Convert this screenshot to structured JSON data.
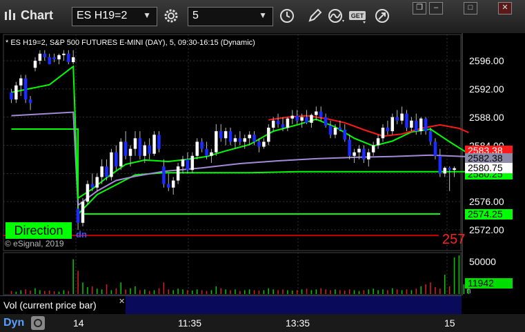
{
  "app": {
    "title": "Chart"
  },
  "toolbar": {
    "symbol": "ES H19=2",
    "interval": "5",
    "dropdown_glyph": "▼"
  },
  "icons": [
    "chart-app-icon",
    "gear-icon",
    "clock-icon",
    "pencil-icon",
    "curve-icon",
    "get-icon",
    "arrow-circle-icon",
    "restore-icon",
    "minimize-icon",
    "maximize-icon",
    "close-icon"
  ],
  "window_buttons": {
    "restore": "❐",
    "minimize": "–",
    "maximize": "□",
    "close": "✕"
  },
  "chart_header": "* ES H19=2, S&P 500 FUTURES E-MINI (DAY), 5, 09:30-16:15 (Dynamic)",
  "direction_label": "Direction",
  "copyright": "© eSignal, 2019",
  "dn_label": "dn",
  "price_axis": {
    "ticks": [
      "2596.00",
      "2592.00",
      "2588.00",
      "2584.00",
      "2576.00",
      "2572.00"
    ],
    "red_line_value": "2583.38",
    "gray_line_value": "2582.38",
    "last_price": "2580.75",
    "green_line_value": "2580.25",
    "support_value": "2574.25",
    "partial_red_label": "257"
  },
  "volume_axis": {
    "tick": "50000",
    "current_volume": "11942",
    "unit_glyph": "n"
  },
  "volume_panel": {
    "label": "Vol (current price bar)",
    "close_glyph": "✕"
  },
  "bottom": {
    "mode": "Dyn",
    "time_ticks": [
      "14",
      "11:35",
      "13:35",
      "15"
    ]
  },
  "colors": {
    "up_candle": "#ffffff",
    "down_candle": "#1a2cff",
    "red_ma": "#ff1a1a",
    "green_ma": "#00ff00",
    "purple_line": "#a58ad8",
    "support_line": "#00ff00",
    "level_line": "#cc0000"
  },
  "chart_data": {
    "type": "candlestick",
    "ylim": [
      2570,
      2599
    ],
    "ohlc": [
      [
        2591.5,
        2592,
        2590,
        2590.5
      ],
      [
        2590.5,
        2593,
        2590,
        2592.5
      ],
      [
        2592.5,
        2594,
        2591,
        2593.5
      ],
      [
        2593.5,
        2594,
        2590,
        2590.5
      ],
      [
        2590.5,
        2591,
        2589,
        2590
      ],
      [
        2595,
        2596.5,
        2594.5,
        2596
      ],
      [
        2596,
        2597.5,
        2595.5,
        2597
      ],
      [
        2597,
        2597.5,
        2596,
        2596.5
      ],
      [
        2596.5,
        2597,
        2595.5,
        2595.5
      ],
      [
        2596.5,
        2597,
        2595.8,
        2596.2
      ],
      [
        2596.2,
        2597,
        2595.5,
        2596.8
      ],
      [
        2596.8,
        2597.5,
        2596,
        2597
      ],
      [
        2597,
        2597.5,
        2595.5,
        2595.8
      ],
      [
        2595.8,
        2597.5,
        2595.5,
        2596.5
      ],
      [
        2575,
        2576,
        2572,
        2573
      ],
      [
        2573,
        2576.5,
        2572.5,
        2576
      ],
      [
        2576,
        2579,
        2575.5,
        2578.5
      ],
      [
        2578.5,
        2580,
        2577.5,
        2578
      ],
      [
        2578,
        2580,
        2577.5,
        2579.5
      ],
      [
        2579.5,
        2582,
        2578.5,
        2581
      ],
      [
        2581,
        2582,
        2579,
        2579.5
      ],
      [
        2579.5,
        2583.5,
        2579,
        2583
      ],
      [
        2583,
        2584,
        2580.5,
        2581
      ],
      [
        2581,
        2585,
        2580.5,
        2584.5
      ],
      [
        2584.5,
        2586,
        2582,
        2582.5
      ],
      [
        2582.5,
        2584,
        2581,
        2583.5
      ],
      [
        2583.5,
        2586,
        2582.5,
        2585
      ],
      [
        2585,
        2586,
        2582,
        2582.5
      ],
      [
        2582.5,
        2584.5,
        2581.5,
        2584
      ],
      [
        2584,
        2585,
        2582,
        2582.8
      ],
      [
        2582.8,
        2586,
        2582.5,
        2585.5
      ],
      [
        2585.5,
        2586,
        2583,
        2583.5
      ],
      [
        2581,
        2582,
        2578,
        2578.5
      ],
      [
        2578.5,
        2580,
        2577.5,
        2578
      ],
      [
        2578,
        2579.5,
        2577,
        2579
      ],
      [
        2579,
        2581.5,
        2578.5,
        2581
      ],
      [
        2581,
        2582.5,
        2580,
        2582
      ],
      [
        2582,
        2583,
        2580,
        2580.5
      ],
      [
        2580.5,
        2583,
        2580,
        2582.5
      ],
      [
        2582.5,
        2585,
        2582,
        2584.5
      ],
      [
        2584.5,
        2585,
        2583,
        2583.5
      ],
      [
        2583.5,
        2584.5,
        2582,
        2582.5
      ],
      [
        2582.5,
        2583.5,
        2581.5,
        2583
      ],
      [
        2583,
        2587,
        2582.5,
        2586
      ],
      [
        2586,
        2587,
        2584.5,
        2585
      ],
      [
        2585,
        2586.5,
        2584,
        2586
      ],
      [
        2586,
        2586.5,
        2584,
        2584.5
      ],
      [
        2584.5,
        2585.5,
        2583.5,
        2585
      ],
      [
        2585,
        2586,
        2584,
        2584.5
      ],
      [
        2584.5,
        2585.5,
        2583.5,
        2585
      ],
      [
        2585,
        2586,
        2584,
        2585.5
      ],
      [
        2585.5,
        2586,
        2584,
        2584.5
      ],
      [
        2584.5,
        2585,
        2583,
        2583.8
      ],
      [
        2583.8,
        2585,
        2583.5,
        2584.5
      ],
      [
        2584.5,
        2587,
        2584,
        2586.5
      ],
      [
        2586.5,
        2588,
        2586,
        2587.5
      ],
      [
        2587.5,
        2588.5,
        2586.5,
        2587
      ],
      [
        2587,
        2588,
        2586,
        2586.5
      ],
      [
        2586.5,
        2588,
        2586,
        2587.8
      ],
      [
        2587.8,
        2589,
        2587,
        2588.2
      ],
      [
        2588.2,
        2589,
        2587,
        2587.5
      ],
      [
        2587.5,
        2588.5,
        2586.5,
        2588
      ],
      [
        2588,
        2589,
        2587,
        2587.2
      ],
      [
        2587.2,
        2588.5,
        2586.5,
        2588.3
      ],
      [
        2588.3,
        2589.5,
        2587.5,
        2588.8
      ],
      [
        2588.8,
        2589.5,
        2587.5,
        2588
      ],
      [
        2588,
        2588.5,
        2586.5,
        2586.8
      ],
      [
        2586.8,
        2587.5,
        2585,
        2585.5
      ],
      [
        2585.5,
        2587,
        2585,
        2586.5
      ],
      [
        2586.5,
        2587.5,
        2586,
        2586.2
      ],
      [
        2586.2,
        2587,
        2584.5,
        2584.8
      ],
      [
        2584.8,
        2585.5,
        2582,
        2582.5
      ],
      [
        2582.5,
        2583.5,
        2581.5,
        2583
      ],
      [
        2583,
        2584,
        2582,
        2583.5
      ],
      [
        2583.5,
        2584,
        2581.5,
        2582
      ],
      [
        2582,
        2583.5,
        2581,
        2583
      ],
      [
        2583,
        2584.5,
        2582.5,
        2584
      ],
      [
        2584,
        2585.5,
        2583.5,
        2585
      ],
      [
        2585,
        2587,
        2584.5,
        2586.5
      ],
      [
        2586.5,
        2587.5,
        2585.5,
        2586
      ],
      [
        2586,
        2588.5,
        2585.5,
        2588
      ],
      [
        2588,
        2589,
        2587,
        2587.5
      ],
      [
        2587.5,
        2589.5,
        2587,
        2588.5
      ],
      [
        2588.5,
        2589,
        2586,
        2586.5
      ],
      [
        2586.5,
        2588,
        2586,
        2587.5
      ],
      [
        2587.5,
        2588.5,
        2585.5,
        2586
      ],
      [
        2586,
        2588,
        2585.5,
        2587.8
      ],
      [
        2587.8,
        2588,
        2585.5,
        2586
      ],
      [
        2586,
        2586.5,
        2584,
        2584.5
      ],
      [
        2584.5,
        2585,
        2582,
        2582.5
      ],
      [
        2582.5,
        2583.5,
        2579.5,
        2580
      ],
      [
        2580,
        2581,
        2579.5,
        2580.8
      ],
      [
        2580.8,
        2581,
        2577.5,
        2580.5
      ],
      [
        2580.5,
        2581,
        2579.5,
        2580.75
      ]
    ],
    "red_ma": [
      [
        54,
        2587.6
      ],
      [
        58,
        2588.0
      ],
      [
        62,
        2588.2
      ],
      [
        66,
        2587.8
      ],
      [
        70,
        2587.2
      ],
      [
        74,
        2586.2
      ],
      [
        78,
        2585.3
      ],
      [
        82,
        2585.6
      ],
      [
        86,
        2586.4
      ],
      [
        90,
        2586.9
      ],
      [
        94,
        2586.4
      ],
      [
        96,
        2585.8
      ]
    ],
    "green_ma": [
      [
        0,
        2591.5
      ],
      [
        8,
        2592.6
      ],
      [
        13,
        2595.2
      ],
      [
        14,
        2576.5
      ],
      [
        17,
        2577.8
      ],
      [
        20,
        2579.4
      ],
      [
        24,
        2581.3
      ],
      [
        28,
        2581.9
      ],
      [
        33,
        2581.7
      ],
      [
        37,
        2582.0
      ],
      [
        41,
        2582.4
      ],
      [
        45,
        2583.2
      ],
      [
        50,
        2584.1
      ],
      [
        55,
        2586.0
      ],
      [
        60,
        2586.9
      ],
      [
        64,
        2587.7
      ],
      [
        68,
        2586.6
      ],
      [
        72,
        2585.0
      ],
      [
        76,
        2583.9
      ],
      [
        80,
        2584.6
      ],
      [
        84,
        2585.9
      ],
      [
        88,
        2586.3
      ],
      [
        92,
        2584.5
      ],
      [
        96,
        2582.8
      ]
    ],
    "purple_line": [
      [
        0,
        2588.2
      ],
      [
        13,
        2588.7
      ],
      [
        14,
        2575.5
      ],
      [
        18,
        2577.5
      ],
      [
        22,
        2579.0
      ],
      [
        26,
        2579.6
      ],
      [
        32,
        2580.3
      ],
      [
        40,
        2580.8
      ],
      [
        48,
        2581.4
      ],
      [
        56,
        2581.8
      ],
      [
        64,
        2582.1
      ],
      [
        72,
        2582.3
      ],
      [
        80,
        2582.4
      ],
      [
        88,
        2582.6
      ],
      [
        96,
        2582.38
      ]
    ],
    "green_flat_line": [
      [
        0,
        2586.3
      ],
      [
        14,
        2586.3
      ],
      [
        14,
        2574.2
      ],
      [
        18,
        2577.0
      ],
      [
        26,
        2579.8
      ],
      [
        32,
        2580.1
      ],
      [
        50,
        2580.1
      ],
      [
        60,
        2580.25
      ],
      [
        96,
        2580.25
      ]
    ],
    "support_line": 2574.25,
    "level_line": 2571.2,
    "volumes": [
      0.08,
      0.06,
      0.1,
      0.12,
      0.09,
      0.15,
      0.1,
      0.08,
      0.09,
      0.07,
      0.06,
      0.1,
      0.08,
      0.9,
      0.6,
      0.3,
      0.18,
      0.2,
      0.14,
      0.12,
      0.25,
      0.1,
      0.15,
      0.3,
      0.12,
      0.15,
      0.2,
      0.1,
      0.12,
      0.08,
      0.1,
      0.15,
      0.3,
      0.12,
      0.1,
      0.14,
      0.12,
      0.1,
      0.09,
      0.12,
      0.1,
      0.08,
      0.1,
      0.2,
      0.15,
      0.12,
      0.1,
      0.12,
      0.08,
      0.1,
      0.12,
      0.1,
      0.09,
      0.1,
      0.15,
      0.12,
      0.1,
      0.12,
      0.1,
      0.09,
      0.1,
      0.12,
      0.14,
      0.1,
      0.12,
      0.15,
      0.12,
      0.1,
      0.12,
      0.1,
      0.09,
      0.12,
      0.1,
      0.08,
      0.1,
      0.12,
      0.14,
      0.1,
      0.12,
      0.1,
      0.15,
      0.12,
      0.1,
      0.12,
      0.1,
      0.14,
      0.2,
      0.25,
      0.3,
      0.18,
      0.14,
      0.5,
      0.2,
      0.95,
      1.0,
      0.25,
      0.15
    ],
    "volume_max": 55000
  }
}
